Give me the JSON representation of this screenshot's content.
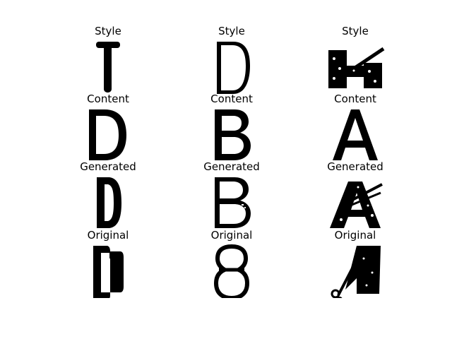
{
  "rows": [
    {
      "label": "Style"
    },
    {
      "label": "Content"
    },
    {
      "label": "Generated"
    },
    {
      "label": "Original"
    }
  ],
  "columns": [
    {
      "style_glyph": "T",
      "content_glyph": "D",
      "generated_glyph": "D",
      "original_glyph": "D"
    },
    {
      "style_glyph": "D",
      "content_glyph": "B",
      "generated_glyph": "B",
      "original_glyph": "B"
    },
    {
      "style_glyph": "H",
      "content_glyph": "A",
      "generated_glyph": "A",
      "original_glyph": "A"
    }
  ],
  "colors": {
    "ink": "#000000",
    "background": "#ffffff"
  }
}
